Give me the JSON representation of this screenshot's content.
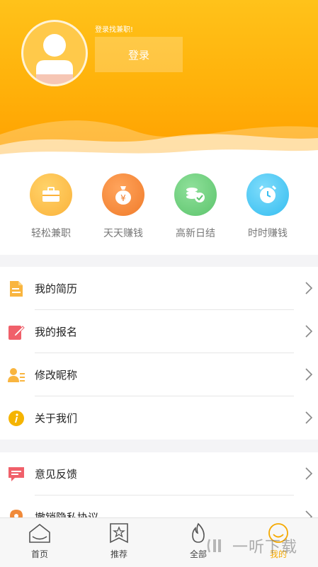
{
  "header": {
    "login_hint": "登录找兼职!",
    "login_button": "登录"
  },
  "quick": [
    {
      "label": "轻松兼职",
      "icon": "briefcase-icon",
      "color": "#fbb640"
    },
    {
      "label": "天天赚钱",
      "icon": "money-bag-icon",
      "color": "#f4892f"
    },
    {
      "label": "高新日结",
      "icon": "coins-icon",
      "color": "#6fce7e"
    },
    {
      "label": "时时赚钱",
      "icon": "clock-icon",
      "color": "#3fc4f1"
    }
  ],
  "menu1": [
    {
      "label": "我的简历",
      "icon": "resume-icon"
    },
    {
      "label": "我的报名",
      "icon": "signup-icon"
    },
    {
      "label": "修改昵称",
      "icon": "user-edit-icon"
    },
    {
      "label": "关于我们",
      "icon": "info-icon"
    }
  ],
  "menu2": [
    {
      "label": "意见反馈",
      "icon": "feedback-icon"
    },
    {
      "label": "撤销隐私协议",
      "icon": "location-icon"
    }
  ],
  "tabs": [
    {
      "label": "首页",
      "icon": "home-icon"
    },
    {
      "label": "推荐",
      "icon": "bookmark-star-icon"
    },
    {
      "label": "全部",
      "icon": "flame-icon"
    },
    {
      "label": "我的",
      "icon": "smile-icon",
      "active": true
    }
  ],
  "watermark": "一听下载",
  "colors": {
    "accent": "#ffb10a",
    "active_tab": "#f5a900"
  }
}
